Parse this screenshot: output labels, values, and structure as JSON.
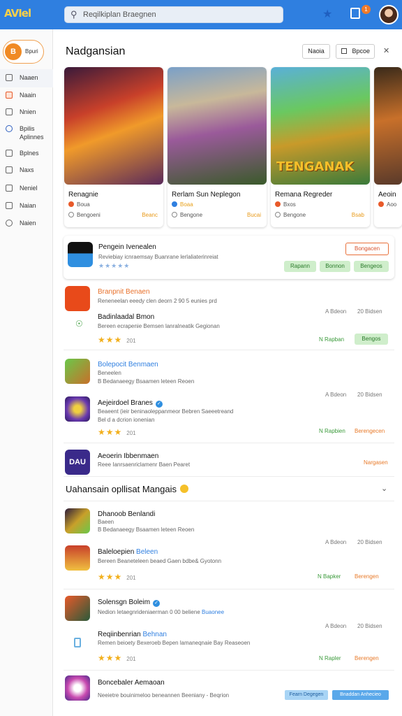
{
  "header": {
    "logo": "AVIel",
    "search_placeholder": "Reqilkiplan Braegnen",
    "badge_count": "1"
  },
  "sidebar": {
    "pill_label": "Bpuri",
    "pill_icon_text": "B",
    "items": [
      {
        "label": "Naaen"
      },
      {
        "label": "Naain"
      },
      {
        "label": "Nnien"
      },
      {
        "label": "Bpilis",
        "sub": "Aplinnes"
      },
      {
        "label": "Bplnes"
      },
      {
        "label": "Naxs"
      },
      {
        "label": "Neniel"
      },
      {
        "label": "Naian"
      },
      {
        "label": "Naien"
      }
    ]
  },
  "page": {
    "title": "Nadgansian",
    "btn_home": "Naoia",
    "btn_options": "Bpcoe"
  },
  "cards": [
    {
      "title": "Renagnie",
      "row1": "Boua",
      "row2": "Bengoeni",
      "price": "Beanc",
      "dot": "#e85a2a"
    },
    {
      "title": "Rerlam Sun Neplegon",
      "row1": "Boaa",
      "row2": "Bengone",
      "price": "Bucai",
      "dot": "#2f7fe0"
    },
    {
      "title": "Remana Regreder",
      "row1": "Bxos",
      "row2": "Bengone",
      "price": "Bsab",
      "dot": "#e85a2a",
      "art_text": "TENGANAK"
    },
    {
      "title": "Aeoin",
      "row1": "Aoo",
      "row2": "",
      "price": "",
      "dot": "#e85a2a"
    }
  ],
  "promo": {
    "name": "Pengein Ivenealen",
    "sub": "Reviebiay icnraemsay Buanrane lerlaliaterinreiat",
    "stars": "★★★★★",
    "btn_outline": "Bongacen",
    "btn1": "Rapann",
    "btn2": "Bonnon",
    "btn3": "Bengeos"
  },
  "list1": {
    "item1_name": "Branpnit Benaen",
    "item1_sub": "Reneneelan eeedy clen deorn 2 90 5 eunies prd",
    "item2_name": "Badinlaadal Bmon",
    "item2_sub": "Bereen ecrapenie Bemsen lanralneatik Gegionan",
    "meta1": "A Bdeon",
    "meta2": "20 Bidsen",
    "rating": "201",
    "btn_a": "N Rapban",
    "btn_b": "Bengos"
  },
  "list2": {
    "item1_name": "Bolepocit Benmaen",
    "item1_sub": "Beneelen",
    "item1_sub2": "B Bedanaeegy Bsaamen leteen Reoen",
    "item2_name": "Aejeirdoel Branes",
    "item2_sub": "Beaeent (ieir beninaoleppanmeor Bebren Saeeetreand",
    "item2_sub2": "Bel d a dcrion ionenian",
    "meta1": "A Bdeon",
    "meta2": "20 Bidsen",
    "rating": "201",
    "btn_a": "N Rapbien",
    "btn_b": "Berengecen"
  },
  "list3": {
    "name": "Aeoerin Ibbenmaen",
    "sub": "Reee Ianrsaenriclamenr Baen Pearet",
    "action": "Nargasen",
    "icon_text": "DAU"
  },
  "section": {
    "title": "Uahansain opllisat Mangais"
  },
  "list4": {
    "item1_name": "Dhanoob Benlandi",
    "item1_sub": "Baeen",
    "item1_sub2": "B Bedanaeegy Bsaamen leteen Reoen",
    "item2_name": "Baleloepien",
    "item2_tag": "Beleen",
    "item2_sub": "Bereen Beaneteleen beaed Gaen bdbe& Gyotonn",
    "meta1": "A Bdeon",
    "meta2": "20 Bidsen",
    "rating": "201",
    "btn_a": "N Bapker",
    "btn_b": "Berengen"
  },
  "list5": {
    "item1_name": "Solensgn Boleim",
    "item1_sub": "Nedion Ietaegnrideniaerman 0 00 beliene",
    "item1_tag": "Buaonee",
    "item2_name": "Reqiinbenrian",
    "item2_tag": "Behnan",
    "item2_sub": "Remen beioety Bexeroeb Bepen lamaneqnaie Bay Reaseoen",
    "meta1": "A Bdeon",
    "meta2": "20 Bidsen",
    "rating": "201",
    "btn_a": "N Rapler",
    "btn_b": "Berengen"
  },
  "list6": {
    "name": "Boncebaler Aemaoan",
    "sub": "Neeietre bouinimeloo beneannen Beeniany - Beqrion",
    "btn1": "Fearn Degegen",
    "btn2": "Bnaddan Anhecieo"
  }
}
